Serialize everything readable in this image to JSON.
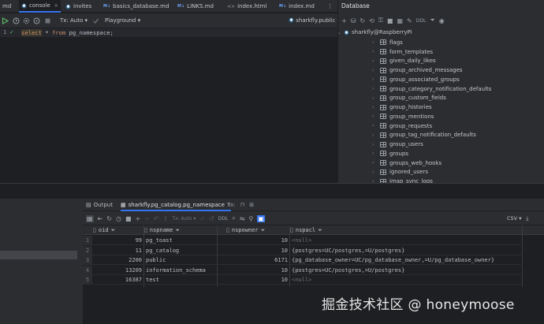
{
  "tabs": [
    {
      "label": "md",
      "kind": "partial"
    },
    {
      "label": "console",
      "kind": "pg",
      "active": true
    },
    {
      "label": "invites",
      "kind": "pg"
    },
    {
      "label": "basics_database.md",
      "kind": "md"
    },
    {
      "label": "LINKS.md",
      "kind": "md"
    },
    {
      "label": "index.html",
      "kind": "html"
    },
    {
      "label": "index.md",
      "kind": "md"
    }
  ],
  "editor_toolbar": {
    "tx_label": "Tx: Auto",
    "playground_label": "Playground",
    "datasource_label": "sharkfly.public"
  },
  "editor": {
    "line_number": "1",
    "sql": {
      "kw1": "select",
      "star": "*",
      "kw2": "from",
      "ident": "pg_namespace",
      "semi": ";"
    }
  },
  "database_panel": {
    "title": "Database",
    "toolbar_ddl": "DDL",
    "root": "sharkfly@RaspberryPi",
    "tables": [
      "flags",
      "form_templates",
      "given_daily_likes",
      "group_archived_messages",
      "group_associated_groups",
      "group_category_notification_defaults",
      "group_custom_fields",
      "group_histories",
      "group_mentions",
      "group_requests",
      "group_tag_notification_defaults",
      "group_users",
      "groups",
      "groups_web_hooks",
      "ignored_users",
      "imap_sync_logs"
    ]
  },
  "services": {
    "output_tab": "Output",
    "result_tab": "sharkfly.pg_catalog.pg_namespace",
    "tx_tab": "Tx:"
  },
  "result_toolbar": {
    "tx_label": "Tx: Auto",
    "ddl_label": "DDL",
    "csv_label": "CSV"
  },
  "grid": {
    "columns": [
      "oid",
      "nspname",
      "nspowner",
      "nspacl"
    ],
    "rows": [
      {
        "n": "1",
        "oid": "99",
        "nspname": "pg_toast",
        "nspowner": "10",
        "nspacl": "<null>"
      },
      {
        "n": "2",
        "oid": "11",
        "nspname": "pg_catalog",
        "nspowner": "10",
        "nspacl": "{postgres=UC/postgres,=U/postgres}"
      },
      {
        "n": "3",
        "oid": "2200",
        "nspname": "public",
        "nspowner": "6171",
        "nspacl": "{pg_database_owner=UC/pg_database_owner,=U/pg_database_owner}"
      },
      {
        "n": "4",
        "oid": "13209",
        "nspname": "information_schema",
        "nspowner": "10",
        "nspacl": "{postgres=UC/postgres,=U/postgres}"
      },
      {
        "n": "5",
        "oid": "16387",
        "nspname": "test",
        "nspowner": "10",
        "nspacl": "<null>"
      }
    ]
  },
  "watermark": "掘金技术社区 @ honeymoose",
  "colors": {
    "accent": "#3574f0",
    "keyword": "#cf8e6d",
    "ok": "#5fb865"
  }
}
